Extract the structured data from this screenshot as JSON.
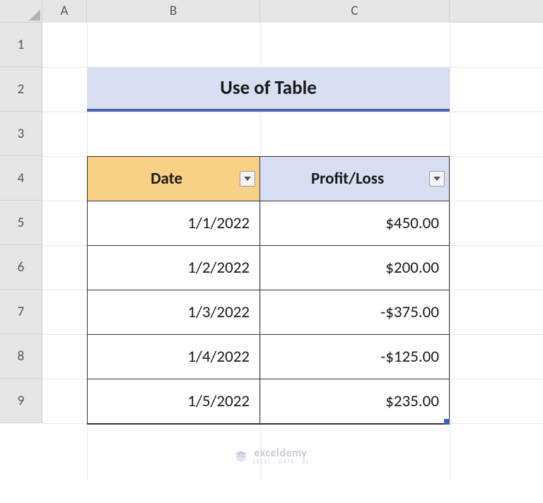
{
  "columns": [
    "A",
    "B",
    "C"
  ],
  "rows": [
    "1",
    "2",
    "3",
    "4",
    "5",
    "6",
    "7",
    "8",
    "9"
  ],
  "title": "Use of Table",
  "table": {
    "headers": {
      "date": "Date",
      "profit_loss": "Profit/Loss"
    },
    "rows": [
      {
        "date": "1/1/2022",
        "profit_loss": "$450.00"
      },
      {
        "date": "1/2/2022",
        "profit_loss": "$200.00"
      },
      {
        "date": "1/3/2022",
        "profit_loss": "-$375.00"
      },
      {
        "date": "1/4/2022",
        "profit_loss": "-$125.00"
      },
      {
        "date": "1/5/2022",
        "profit_loss": "$235.00"
      }
    ]
  },
  "watermark": {
    "brand": "exceldemy",
    "tagline": "EXCEL · DATA · BI"
  }
}
